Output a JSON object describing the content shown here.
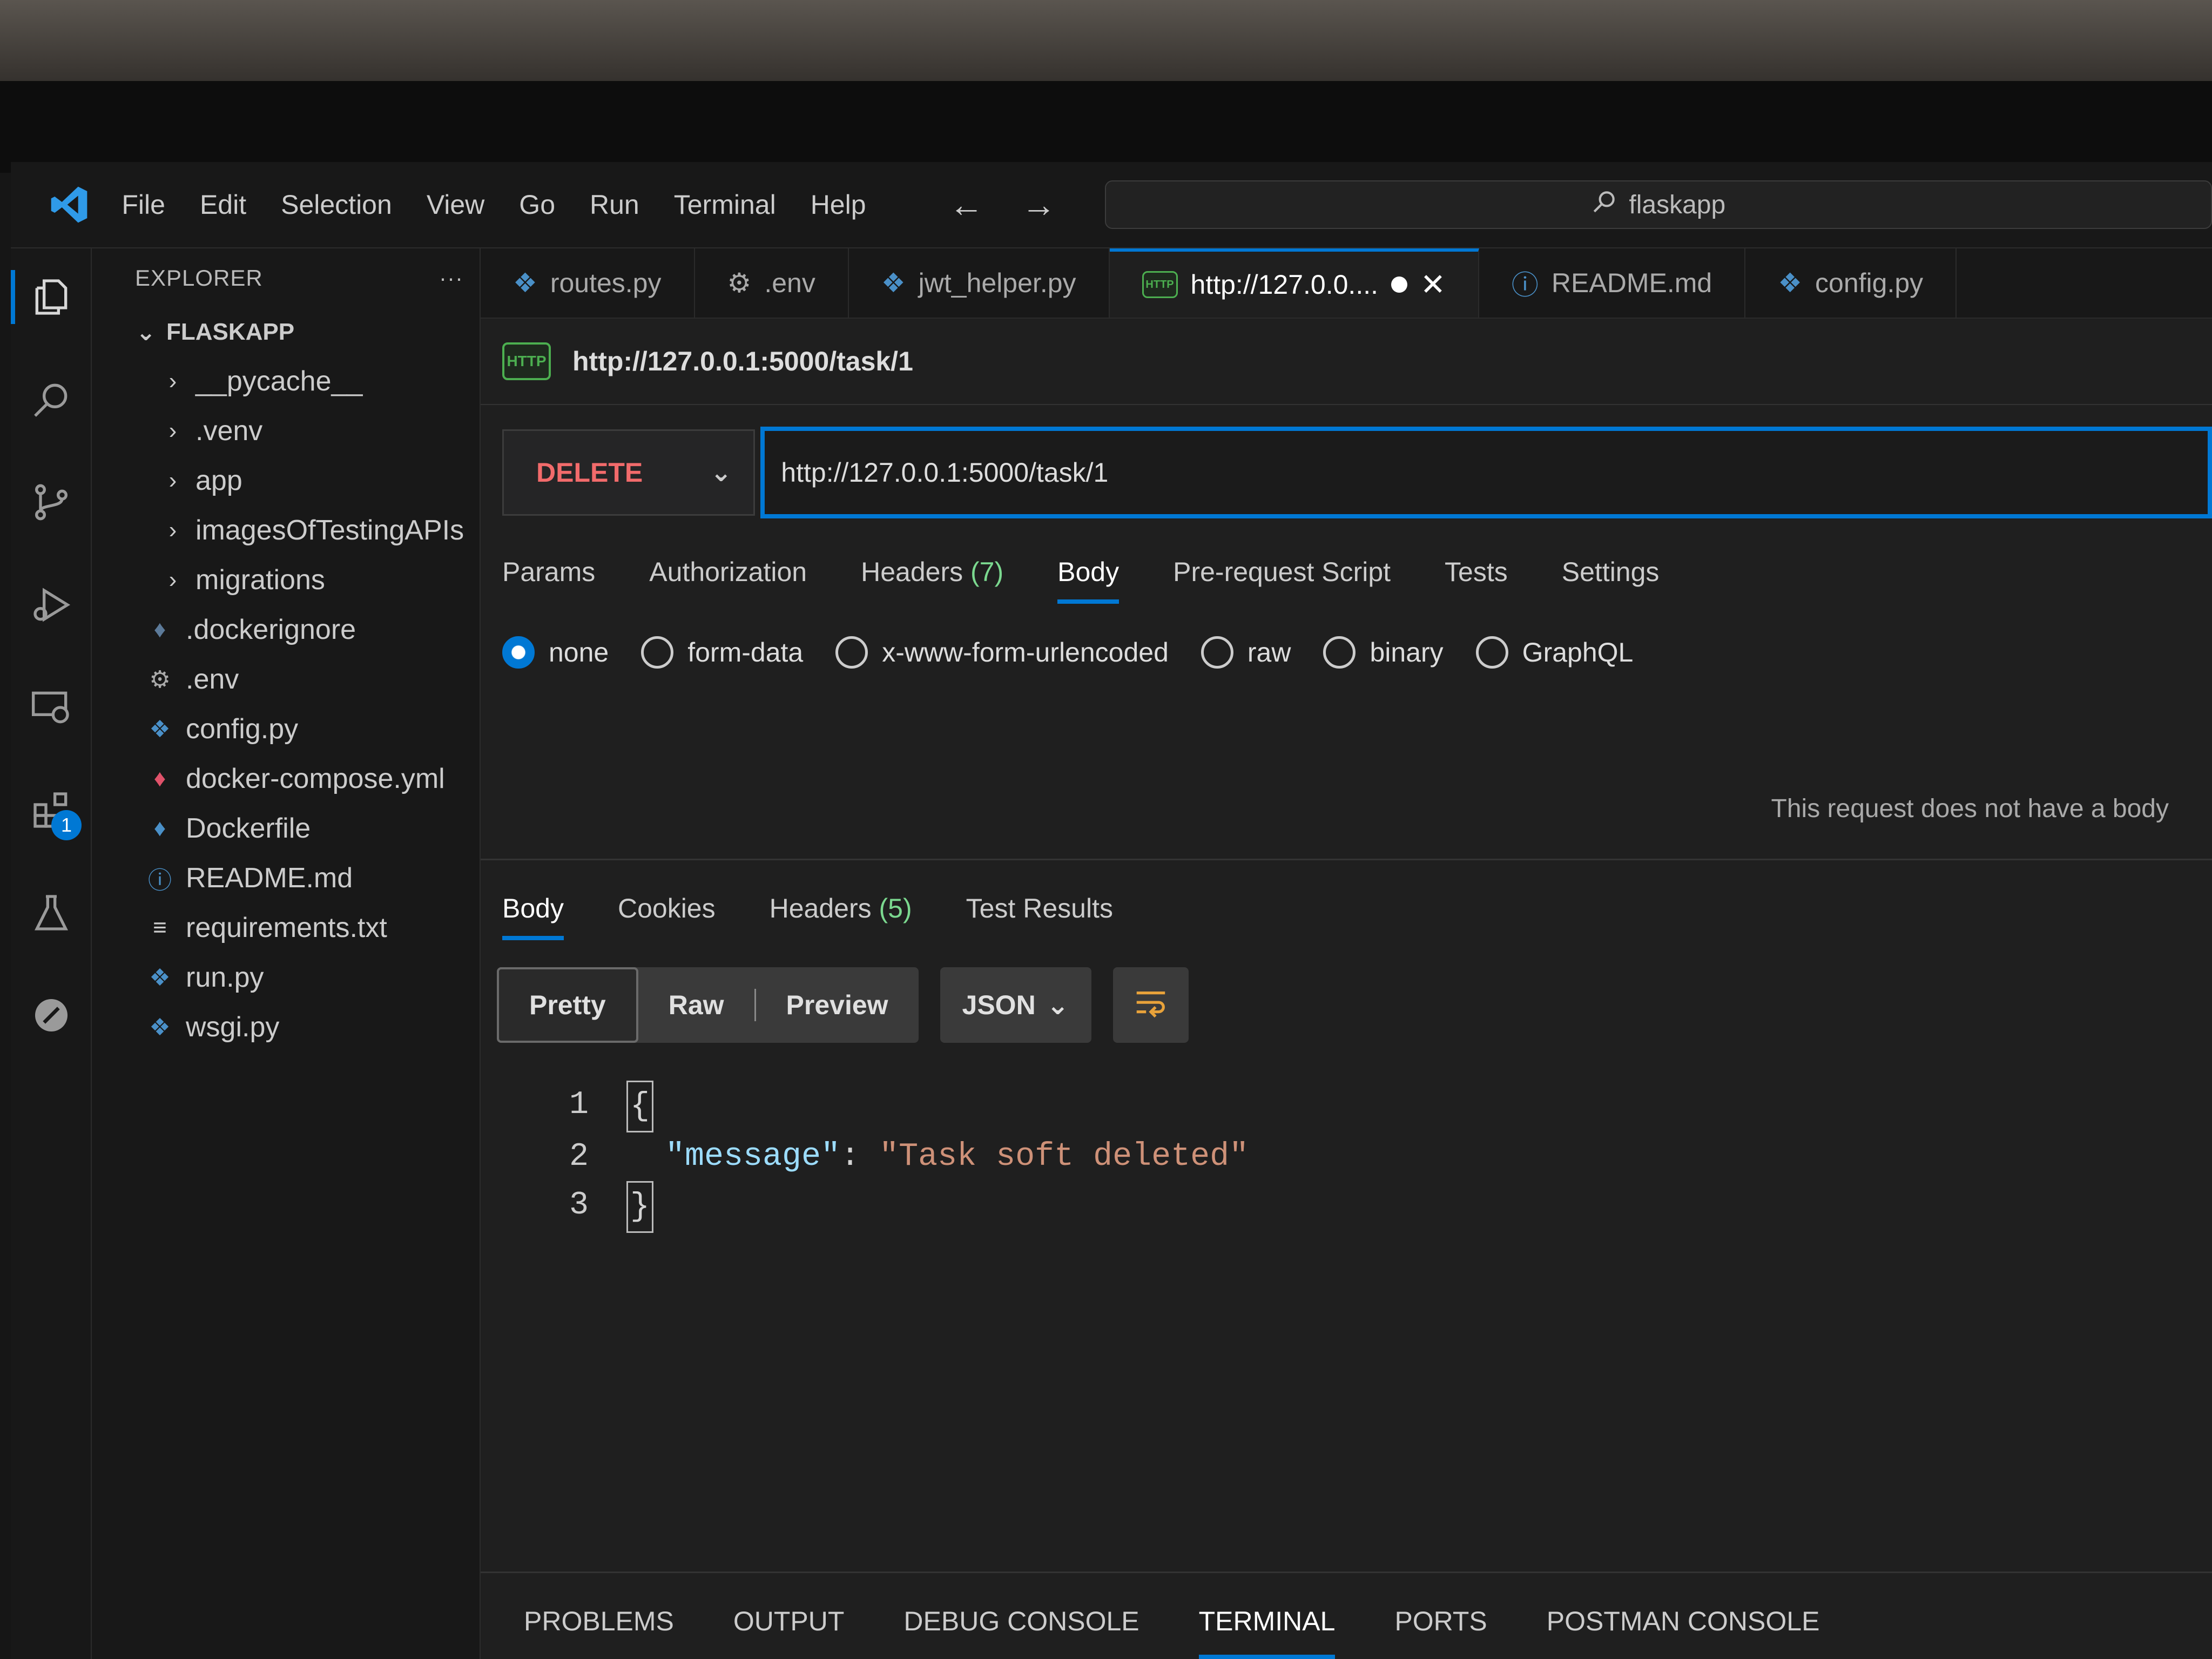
{
  "window": {
    "menu": [
      "File",
      "Edit",
      "Selection",
      "View",
      "Go",
      "Run",
      "Terminal",
      "Help"
    ],
    "command_center": "flaskapp"
  },
  "activity_bar": {
    "icons": [
      "files-icon",
      "search-icon",
      "source-control-icon",
      "run-debug-icon",
      "remote-explorer-icon",
      "extensions-icon",
      "testing-icon",
      "postman-icon"
    ],
    "extensions_badge": "1"
  },
  "explorer": {
    "header": "EXPLORER",
    "more": "···",
    "root": "FLASKAPP",
    "folders": [
      "__pycache__",
      ".venv",
      "app",
      "imagesOfTestingAPIs",
      "migrations"
    ],
    "files": [
      ".dockerignore",
      ".env",
      "config.py",
      "docker-compose.yml",
      "Dockerfile",
      "README.md",
      "requirements.txt",
      "run.py",
      "wsgi.py"
    ]
  },
  "tabs": [
    {
      "label": "routes.py",
      "icon": "python-icon"
    },
    {
      "label": ".env",
      "icon": "gear-icon"
    },
    {
      "label": "jwt_helper.py",
      "icon": "python-icon"
    },
    {
      "label": "http://127.0.0....",
      "icon": "http-icon",
      "active": true
    },
    {
      "label": "README.md",
      "icon": "info-icon"
    },
    {
      "label": "config.py",
      "icon": "python-icon"
    }
  ],
  "request": {
    "http_badge": "HTTP",
    "title": "http://127.0.0.1:5000/task/1",
    "method": "DELETE",
    "url": "http://127.0.0.1:5000/task/1",
    "tabs": {
      "params": "Params",
      "authorization": "Authorization",
      "headers": "Headers",
      "headers_count": "(7)",
      "body": "Body",
      "pre_request": "Pre-request Script",
      "tests": "Tests",
      "settings": "Settings"
    },
    "body_types": [
      "none",
      "form-data",
      "x-www-form-urlencoded",
      "raw",
      "binary",
      "GraphQL"
    ],
    "selected_body_type": "none",
    "no_body_message": "This request does not have a body"
  },
  "response": {
    "tabs": {
      "body": "Body",
      "cookies": "Cookies",
      "headers": "Headers",
      "headers_count": "(5)",
      "test_results": "Test Results"
    },
    "views": [
      "Pretty",
      "Raw",
      "Preview"
    ],
    "format": "JSON",
    "lines": [
      "1",
      "2",
      "3"
    ],
    "json_open": "{",
    "json_key": "\"message\"",
    "json_colon": ": ",
    "json_value": "\"Task soft deleted\"",
    "json_close": "}"
  },
  "panel": {
    "tabs": [
      "PROBLEMS",
      "OUTPUT",
      "DEBUG CONSOLE",
      "TERMINAL",
      "PORTS",
      "POSTMAN CONSOLE"
    ],
    "active": "TERMINAL"
  },
  "colors": {
    "accent": "#0078d4",
    "method_delete": "#f26b6b",
    "json_key": "#9cdcfe",
    "json_string": "#ce9178"
  }
}
